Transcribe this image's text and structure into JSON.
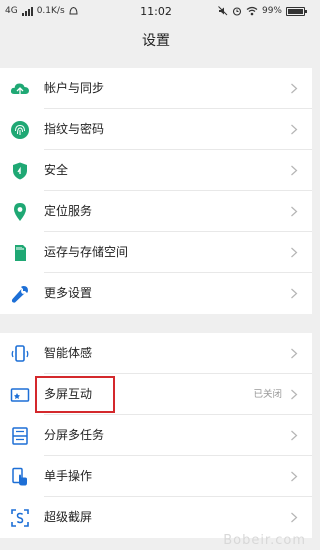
{
  "status_bar": {
    "network": "4G",
    "speed": "0.1K/s",
    "time": "11:02",
    "battery": "99%"
  },
  "page": {
    "title": "设置"
  },
  "groups": [
    {
      "items": [
        {
          "label": "帐户与同步",
          "icon": "cloud-icon",
          "color": "#1fa874"
        },
        {
          "label": "指纹与密码",
          "icon": "fingerprint-icon",
          "color": "#1fa874"
        },
        {
          "label": "安全",
          "icon": "shield-icon",
          "color": "#1fa874"
        },
        {
          "label": "定位服务",
          "icon": "location-pin-icon",
          "color": "#1fa874"
        },
        {
          "label": "运存与存储空间",
          "icon": "sd-card-icon",
          "color": "#1fa874"
        },
        {
          "label": "更多设置",
          "icon": "wrench-icon",
          "color": "#1d6fd6"
        }
      ]
    },
    {
      "items": [
        {
          "label": "智能体感",
          "icon": "phone-motion-icon",
          "color": "#1d6fd6"
        },
        {
          "label": "多屏互动",
          "value": "已关闭",
          "icon": "cast-screen-icon",
          "color": "#1d6fd6"
        },
        {
          "label": "分屏多任务",
          "icon": "split-screen-icon",
          "color": "#1d6fd6"
        },
        {
          "label": "单手操作",
          "icon": "one-hand-icon",
          "color": "#1d6fd6"
        },
        {
          "label": "超级截屏",
          "icon": "screenshot-icon",
          "color": "#1d6fd6"
        }
      ]
    }
  ],
  "watermark": "Bobeir.com"
}
